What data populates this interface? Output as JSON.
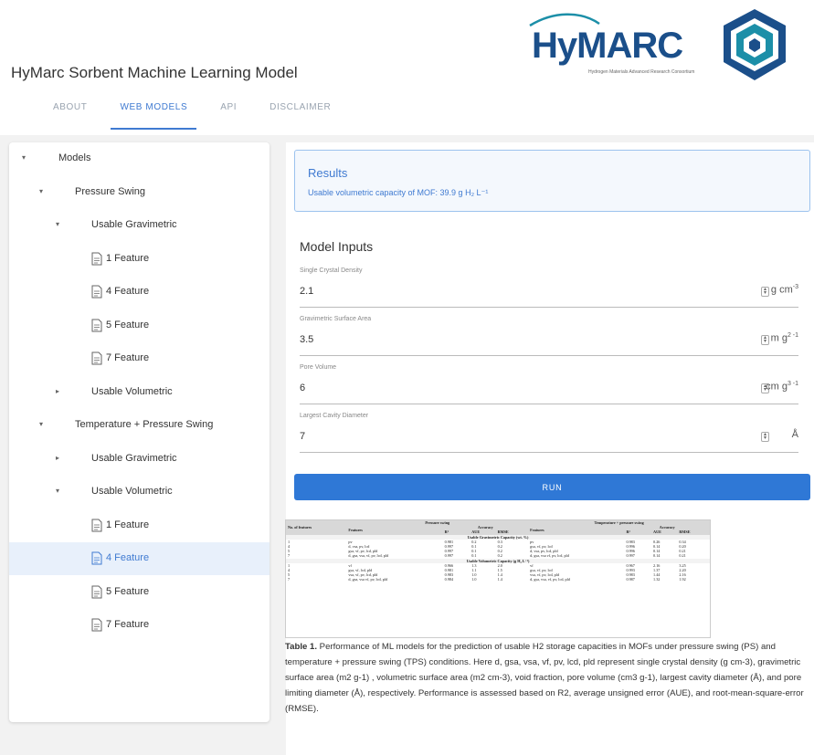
{
  "header": {
    "app_title": "HyMarc Sorbent Machine Learning Model",
    "logo_text": "HyMARC",
    "logo_tagline": "Hydrogen Materials Advanced Research Consortium"
  },
  "tabs": [
    {
      "label": "ABOUT",
      "active": false
    },
    {
      "label": "WEB MODELS",
      "active": true
    },
    {
      "label": "API",
      "active": false
    },
    {
      "label": "DISCLAIMER",
      "active": false
    }
  ],
  "sidebar": {
    "items": [
      {
        "label": "Models",
        "caret": "▾"
      },
      {
        "label": "Pressure Swing",
        "caret": "▾"
      },
      {
        "label": "Usable Gravimetric",
        "caret": "▾"
      },
      {
        "label": "1 Feature"
      },
      {
        "label": "4 Feature"
      },
      {
        "label": "5 Feature"
      },
      {
        "label": "7 Feature"
      },
      {
        "label": "Usable Volumetric",
        "caret": "▸"
      },
      {
        "label": "Temperature + Pressure Swing",
        "caret": "▾"
      },
      {
        "label": "Usable Gravimetric",
        "caret": "▸"
      },
      {
        "label": "Usable Volumetric",
        "caret": "▾"
      },
      {
        "label": "1 Feature"
      },
      {
        "label": "4 Feature",
        "selected": true
      },
      {
        "label": "5 Feature"
      },
      {
        "label": "7 Feature"
      }
    ]
  },
  "results": {
    "title": "Results",
    "text": "Usable volumetric capacity of MOF: 39.9 g H₂ L⁻¹"
  },
  "model_inputs": {
    "title": "Model Inputs",
    "fields": [
      {
        "label": "Single Crystal Density",
        "value": "2.1",
        "unit": "g cm",
        "unit_sup": "-3"
      },
      {
        "label": "Gravimetric Surface Area",
        "value": "3.5",
        "unit": "m  g",
        "unit_sup": "2  -1"
      },
      {
        "label": "Pore Volume",
        "value": "6",
        "unit": "cm  g",
        "unit_sup": "3  -1"
      },
      {
        "label": "Largest Cavity Diameter",
        "value": "7",
        "unit": "Å",
        "unit_sup": ""
      }
    ],
    "run_label": "RUN"
  },
  "table": {
    "col_n": "No. of features",
    "col_ps": "Pressure swing",
    "col_tps": "Temperature + pressure swing",
    "col_features": "Features",
    "col_accuracy": "Accuracy",
    "col_r2": "R²",
    "col_aue": "AUE",
    "col_rmse": "RMSE",
    "sec1": "Usable Gravimetric Capacity (wt. %)",
    "sec2": "Usable Volumetric Capacity (g H₂ L⁻¹)",
    "rows1": [
      [
        "1",
        "pv",
        "0.981",
        "0.2",
        "0.3",
        "pv",
        "0.983",
        "0.26",
        "0.34"
      ],
      [
        "4",
        "d, vsa, pv, lcd",
        "0.997",
        "0.1",
        "0.2",
        "gsa, vf, pv, lcd",
        "0.996",
        "0.14",
        "0.20"
      ],
      [
        "5",
        "gsa, vf, pv, lcd, pld",
        "0.997",
        "0.1",
        "0.2",
        "d, vsa, pv, lcd, pld",
        "0.996",
        "0.14",
        "0.21"
      ],
      [
        "7",
        "d, gsa, vsa, vf, pv, lcd, pld",
        "0.997",
        "0.1",
        "0.2",
        "d, gsa, vsa vf, pv, lcd, pld",
        "0.997",
        "0.14",
        "0.21"
      ]
    ],
    "rows2": [
      [
        "1",
        "vf",
        "0.966",
        "1.3",
        "2.0",
        "vf",
        "0.967",
        "2.16",
        "3.25"
      ],
      [
        "4",
        "gsa, vf, lcd, pld",
        "0.981",
        "1.1",
        "1.5",
        "gsa, vf, pv, lcd",
        "0.993",
        "1.37",
        "2.20"
      ],
      [
        "5",
        "vsa, vf, pv, lcd, pld",
        "0.983",
        "1.0",
        "1.4",
        "vsa, vf, pv, lcd, pld",
        "0.983",
        "1.44",
        "2.16"
      ],
      [
        "7",
        "d, gsa, vsa vf, pv, lcd, pld",
        "0.984",
        "1.0",
        "1.4",
        "d, gsa, vsa, vf, pv, lcd, pld",
        "0.987",
        "1.32",
        "1.92"
      ]
    ]
  },
  "caption": {
    "lead": "Table 1.",
    "text": " Performance of ML models for the prediction of usable H2 storage capacities in MOFs under pressure swing (PS) and temperature + pressure swing (TPS) conditions. Here d, gsa, vsa, vf, pv, lcd, pld represent single crystal density (g cm-3), gravimetric surface area (m2 g-1) , volumetric surface area (m2 cm-3), void fraction, pore volume (cm3 g-1), largest cavity diameter (Å), and pore limiting diameter (Å), respectively. Performance is assessed based on R2, average unsigned error (AUE), and root-mean-square-error (RMSE)."
  },
  "colors": {
    "accent": "#3f7ad1",
    "run_button": "#2f78d6",
    "logo_blue": "#1b4f8a",
    "logo_teal": "#1c8fa8",
    "selected_bg": "#e8f0fb"
  },
  "icons": {
    "tree_leaf": "document-icon",
    "tree_caret": "caret-icon",
    "stepper": "stepper-icon",
    "logo": "hymarc-cube-logo"
  }
}
